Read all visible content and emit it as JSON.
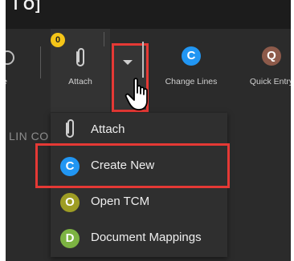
{
  "title_fragment": "I O]",
  "toolbar": {
    "schedule_label": "ule",
    "attach_label": "Attach",
    "attach_count": "0",
    "change_lines_label": "Change Lines",
    "change_lines_letter": "C",
    "quick_entry_label": "Quick Entry",
    "quick_entry_letter": "Q"
  },
  "background_text": "LIN CO",
  "dropdown": {
    "items": [
      {
        "label": "Attach",
        "icon": "paperclip-icon"
      },
      {
        "label": "Create New",
        "letter": "C",
        "color": "#2196f3"
      },
      {
        "label": "Open TCM",
        "letter": "O",
        "color": "#9e9d24"
      },
      {
        "label": "Document Mappings",
        "letter": "D",
        "color": "#7cb342"
      }
    ]
  },
  "colors": {
    "highlight": "#e53935",
    "badge": "#f5c518",
    "change_lines": "#2196f3",
    "quick_entry": "#8d5a4a"
  }
}
